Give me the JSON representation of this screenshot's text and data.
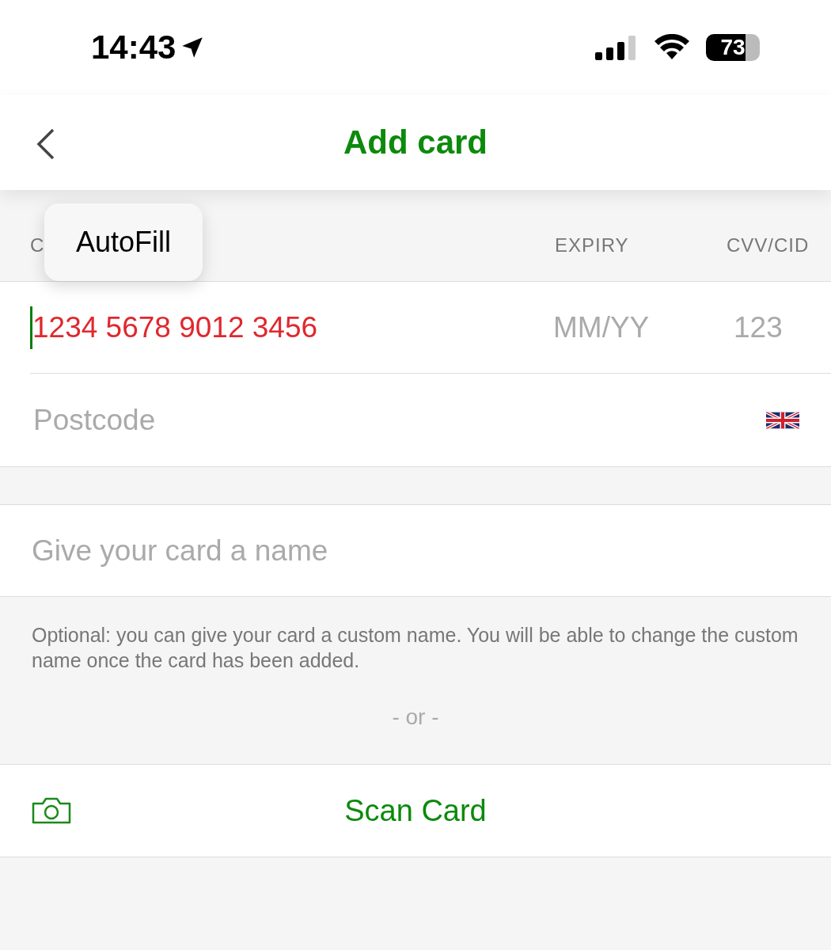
{
  "status_bar": {
    "time": "14:43",
    "battery": "73"
  },
  "nav": {
    "title": "Add card"
  },
  "card_form": {
    "headers": [
      "C",
      "EXPIRY",
      "CVV/CID"
    ],
    "autofill": "AutoFill",
    "card_number": {
      "value": "1234 5678 9012 3456",
      "invalid": true,
      "focused": true
    },
    "expiry": {
      "placeholder": "MM/YY"
    },
    "cvv": {
      "placeholder": "123"
    },
    "postcode": {
      "placeholder": "Postcode"
    }
  },
  "name_field": {
    "placeholder": "Give your card a name"
  },
  "note": "Optional: you can give your card a custom name. You will be able to change the custom name once the card has been added.",
  "separator": "- or -",
  "scan_button": "Scan Card"
}
